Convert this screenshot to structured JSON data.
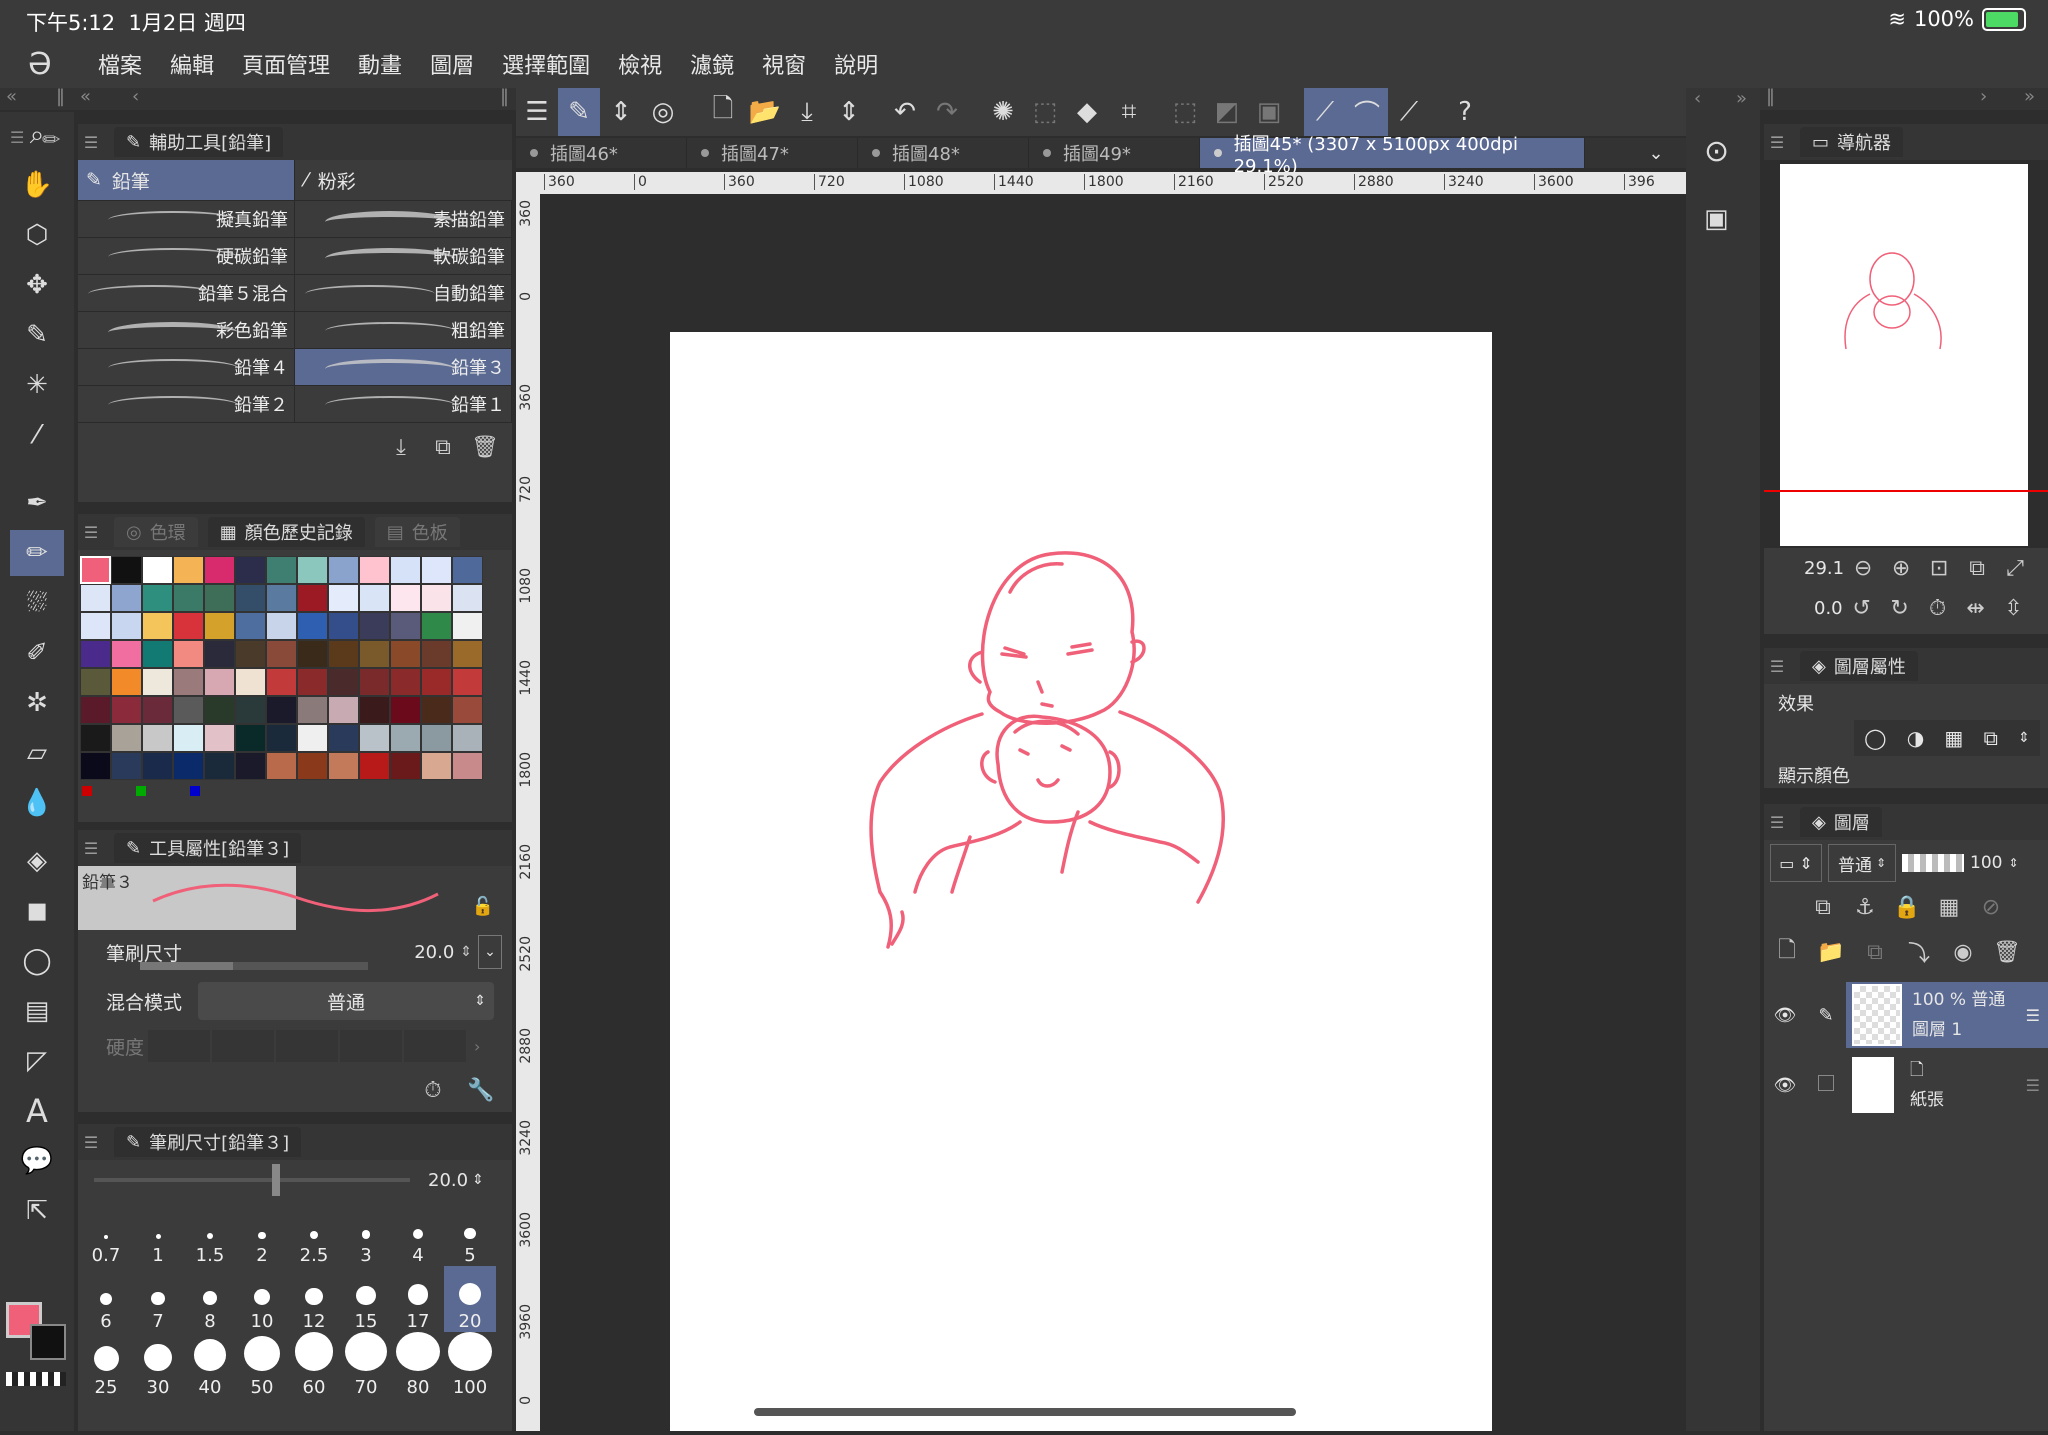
{
  "status": {
    "time": "下午5:12",
    "date": "1月2日 週四",
    "battery": "100%"
  },
  "menu": [
    "檔案",
    "編輯",
    "頁面管理",
    "動畫",
    "圖層",
    "選擇範圍",
    "檢視",
    "濾鏡",
    "視窗",
    "說明"
  ],
  "subtool_panel": {
    "title": "輔助工具[鉛筆]",
    "tabs": [
      "鉛筆",
      "粉彩"
    ],
    "brushes": [
      [
        "擬真鉛筆",
        "素描鉛筆"
      ],
      [
        "硬碳鉛筆",
        "軟碳鉛筆"
      ],
      [
        "鉛筆５混合",
        "自動鉛筆"
      ],
      [
        "彩色鉛筆",
        "粗鉛筆"
      ],
      [
        "鉛筆４",
        "鉛筆３"
      ],
      [
        "鉛筆２",
        "鉛筆１"
      ]
    ]
  },
  "color_panel": {
    "tabs": [
      "色環",
      "顏色歷史記錄",
      "色板"
    ],
    "swatches": [
      [
        "#f0607a",
        "#111111",
        "#ffffff",
        "#f4b455",
        "#d82b6e",
        "#2b2d4a",
        "#3f7f72",
        "#8cc7bd",
        "#8aa3cc",
        "#ffc2cf",
        "#d6e2f7",
        "#dde6fb",
        "#4f6a9a"
      ],
      [
        "#dde6f7",
        "#8ea6cf",
        "#2f8f7f",
        "#3c7a68",
        "#3e6e57",
        "#344e6a",
        "#5a7aa0",
        "#9b1a24",
        "#e4ecfb",
        "#d9e4f6",
        "#fde6ee",
        "#fbe3ea",
        "#dbe3f2"
      ],
      [
        "#dde6f9",
        "#c9d6f0",
        "#f3c55a",
        "#d8323a",
        "#d4a12a",
        "#4d6e9e",
        "#c7d4ea",
        "#2f5fb0",
        "#344e8c",
        "#3b3b5a",
        "#5a5a7a",
        "#2f8a4a",
        "#f0f0f0"
      ],
      [
        "#4a2a8a",
        "#f06ea0",
        "#127a72",
        "#f28a82",
        "#2a2a3a",
        "#4a3a2a",
        "#8a4a3a",
        "#3a2a1a",
        "#5a3a1a",
        "#7a5a2a",
        "#8a4a2a",
        "#6a3a2a",
        "#9a6a2a"
      ],
      [
        "#5a5a3a",
        "#f28a2a",
        "#eee8dc",
        "#9a7a7a",
        "#d8a8b2",
        "#efe2d2",
        "#c23a3a",
        "#8a2a2a",
        "#4a2a2a",
        "#7a2a2a",
        "#8a2a2a",
        "#9a2a2a",
        "#c23a3a"
      ],
      [
        "#5a1a2a",
        "#8a2a3a",
        "#6a2a3a",
        "#5a5a5a",
        "#2a3a2a",
        "#2a3a3a",
        "#1a1a2a",
        "#8a7a7a",
        "#c8aab2",
        "#3a1a1a",
        "#6a0a1a",
        "#4a2a1a",
        "#9a4a3a"
      ],
      [
        "#1a1a1a",
        "#a8a298",
        "#c8c8c8",
        "#d8eef4",
        "#e2c2c8",
        "#0a2a2a",
        "#1a2a3a",
        "#efefef",
        "#2a3a5a",
        "#b8c2c8",
        "#9aaab0",
        "#8a9aa0",
        "#a8b2b8"
      ],
      [
        "#0a0a1a",
        "#2a3a5a",
        "#1a2a4a",
        "#0a2a6a",
        "#1a2a3a",
        "#1a1a2a",
        "#b86a4a",
        "#8a3a1a",
        "#c27a5a",
        "#b81a1a",
        "#6a1a1a",
        "#d8a890",
        "#c88a8a"
      ]
    ]
  },
  "tool_property": {
    "title": "工具屬性[鉛筆３]",
    "preset_name": "鉛筆３",
    "brush_size_label": "筆刷尺寸",
    "brush_size_value": "20.0",
    "blend_label": "混合模式",
    "blend_value": "普通",
    "hardness_label": "硬度"
  },
  "brush_size_panel": {
    "title": "筆刷尺寸[鉛筆３]",
    "value": "20.0",
    "sizes": [
      "0.7",
      "1",
      "1.5",
      "2",
      "2.5",
      "3",
      "4",
      "5",
      "6",
      "7",
      "8",
      "10",
      "12",
      "15",
      "17",
      "20",
      "25",
      "30",
      "40",
      "50",
      "60",
      "70",
      "80",
      "100"
    ],
    "selected": "20"
  },
  "doc_tabs": [
    "插圖46*",
    "插圖47*",
    "插圖48*",
    "插圖49*",
    "插圖45* (3307 x 5100px 400dpi 29.1%)"
  ],
  "ruler_h": [
    "360",
    "0",
    "360",
    "720",
    "1080",
    "1440",
    "1800",
    "2160",
    "2520",
    "2880",
    "3240",
    "3600",
    "396"
  ],
  "ruler_v": [
    "360",
    "0",
    "360",
    "720",
    "1080",
    "1440",
    "1800",
    "2160",
    "2520",
    "2880",
    "3240",
    "3600",
    "3960",
    "0"
  ],
  "navigator": {
    "title": "導航器",
    "zoom": "29.1",
    "rotation": "0.0"
  },
  "layer_property": {
    "title": "圖層屬性",
    "effect_label": "效果",
    "display_color_label": "顯示顏色"
  },
  "layers_panel": {
    "title": "圖層",
    "blend": "普通",
    "opacity": "100",
    "layers": [
      {
        "opacity_mode": "100 % 普通",
        "name": "圖層 1"
      },
      {
        "name": "紙張"
      }
    ]
  },
  "colors": {
    "accent": "#5b6a92",
    "sketch": "#f06078"
  }
}
